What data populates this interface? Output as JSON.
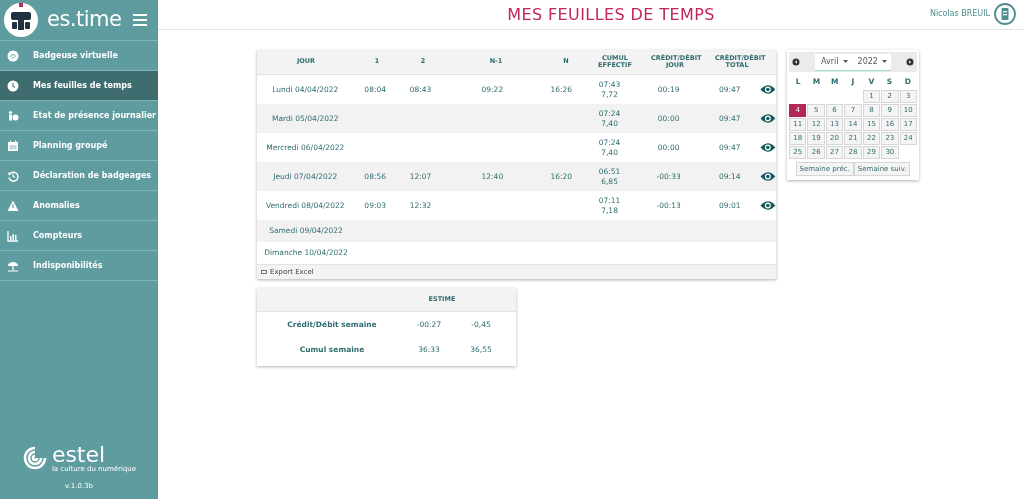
{
  "app": {
    "name": "es.time",
    "version": "v.1.0.3b",
    "brand": "estel",
    "tagline": "la culture du numérique"
  },
  "sidebar": {
    "items": [
      {
        "label": "Badgeuse virtuelle",
        "selected": false
      },
      {
        "label": "Mes feuilles de temps",
        "selected": true
      },
      {
        "label": "Etat de présence journalier",
        "selected": false
      },
      {
        "label": "Planning groupé",
        "selected": false
      },
      {
        "label": "Déclaration de badgeages",
        "selected": false
      },
      {
        "label": "Anomalies",
        "selected": false
      },
      {
        "label": "Compteurs",
        "selected": false
      },
      {
        "label": "Indisponibilités",
        "selected": false
      }
    ]
  },
  "page_title": "MES FEUILLES DE TEMPS",
  "user": {
    "name": "Nicolas BREUIL"
  },
  "timesheet": {
    "columns": [
      "JOUR",
      "1",
      "2",
      "N-1",
      "N",
      "CUMUL EFFECTIF",
      "CRÉDIT/DÉBIT JOUR",
      "CRÉDIT/DÉBIT TOTAL"
    ],
    "rows": [
      {
        "day": "Lundi 04/04/2022",
        "in1": "08:04",
        "out1": "08:43",
        "in2": "09:22",
        "out2": "16:26",
        "cumul": "07:43",
        "cumul_dec": "7,72",
        "day_balance": "00:19",
        "total": "09:47",
        "details": true
      },
      {
        "day": "Mardi 05/04/2022",
        "cumul": "07:24",
        "cumul_dec": "7,40",
        "day_balance": "00:00",
        "total": "09:47",
        "details": true
      },
      {
        "day": "Mercredi 06/04/2022",
        "cumul": "07:24",
        "cumul_dec": "7,40",
        "day_balance": "00:00",
        "total": "09:47",
        "details": true
      },
      {
        "day": "Jeudi 07/04/2022",
        "in1": "08:56",
        "out1": "12:07",
        "in2": "12:40",
        "out2": "16:20",
        "cumul": "06:51",
        "cumul_dec": "6,85",
        "day_balance": "-00:33",
        "total": "09:14",
        "details": true
      },
      {
        "day": "Vendredi 08/04/2022",
        "in1": "09:03",
        "out1": "12:32",
        "cumul": "07:11",
        "cumul_dec": "7,18",
        "day_balance": "-00:13",
        "total": "09:01",
        "details": true
      },
      {
        "day": "Samedi 09/04/2022",
        "details": false
      },
      {
        "day": "Dimanche 10/04/2022",
        "details": false
      }
    ],
    "export_label": "Export Excel"
  },
  "summary": {
    "header": "ESTIME",
    "rows": [
      {
        "label": "Crédit/Débit semaine",
        "hours": "-00:27",
        "decimal": "-0,45"
      },
      {
        "label": "Cumul semaine",
        "hours": "36:33",
        "decimal": "36,55"
      }
    ]
  },
  "calendar": {
    "month": "Avril",
    "year": "2022",
    "weekdays": [
      "L",
      "M",
      "M",
      "J",
      "V",
      "S",
      "D"
    ],
    "weeks": [
      [
        {
          "day": "1",
          "selected": false
        },
        {
          "day": "2",
          "selected": false
        },
        {
          "day": "3",
          "selected": false
        }
      ],
      [
        {
          "day": "4",
          "selected": true
        },
        {
          "day": "5",
          "selected": false
        },
        {
          "day": "6",
          "selected": false
        },
        {
          "day": "7",
          "selected": false
        },
        {
          "day": "8",
          "selected": false
        },
        {
          "day": "9",
          "selected": false
        },
        {
          "day": "10",
          "selected": false
        }
      ],
      [
        {
          "day": "11",
          "selected": false
        },
        {
          "day": "12",
          "selected": false
        },
        {
          "day": "13",
          "selected": false
        },
        {
          "day": "14",
          "selected": false
        },
        {
          "day": "15",
          "selected": false
        },
        {
          "day": "16",
          "selected": false
        },
        {
          "day": "17",
          "selected": false
        }
      ],
      [
        {
          "day": "18",
          "selected": false
        },
        {
          "day": "19",
          "selected": false
        },
        {
          "day": "20",
          "selected": false
        },
        {
          "day": "21",
          "selected": false
        },
        {
          "day": "22",
          "selected": false
        },
        {
          "day": "23",
          "selected": false
        },
        {
          "day": "24",
          "selected": false
        }
      ],
      [
        {
          "day": "25",
          "selected": false
        },
        {
          "day": "26",
          "selected": false
        },
        {
          "day": "27",
          "selected": false
        },
        {
          "day": "28",
          "selected": false
        },
        {
          "day": "29",
          "selected": false
        },
        {
          "day": "30",
          "selected": false
        }
      ]
    ],
    "buttons": [
      "Semaine préc.",
      "Semaine suiv."
    ]
  }
}
